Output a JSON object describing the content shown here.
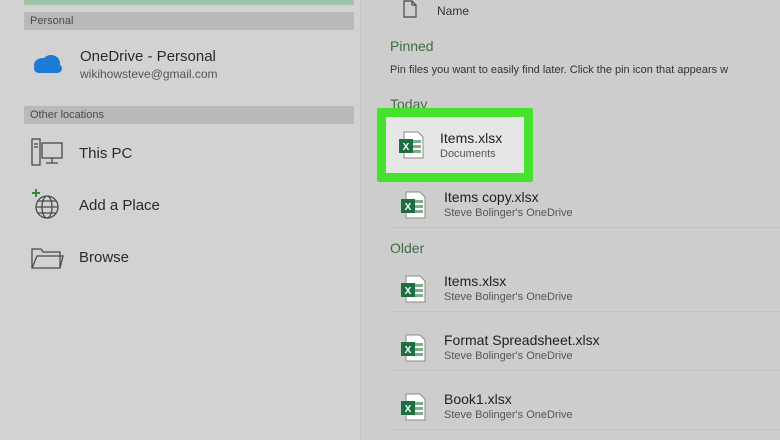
{
  "sidebar": {
    "personal_label": "Personal",
    "onedrive": {
      "title": "OneDrive - Personal",
      "email": "wikihowsteve@gmail.com"
    },
    "other_locations_label": "Other locations",
    "locations": [
      {
        "label": "This PC",
        "icon": "computer-icon"
      },
      {
        "label": "Add a Place",
        "icon": "add-globe-icon"
      },
      {
        "label": "Browse",
        "icon": "folder-icon"
      }
    ]
  },
  "file_list": {
    "column_name": "Name",
    "pinned": {
      "title": "Pinned",
      "hint": "Pin files you want to easily find later. Click the pin icon that appears w"
    },
    "today": {
      "title": "Today",
      "files": [
        {
          "name": "Items.xlsx",
          "location": "Documents"
        },
        {
          "name": "Items copy.xlsx",
          "location": "Steve Bolinger's OneDrive"
        }
      ]
    },
    "older": {
      "title": "Older",
      "files": [
        {
          "name": "Items.xlsx",
          "location": "Steve Bolinger's OneDrive"
        },
        {
          "name": "Format Spreadsheet.xlsx",
          "location": "Steve Bolinger's OneDrive"
        },
        {
          "name": "Book1.xlsx",
          "location": "Steve Bolinger's OneDrive"
        }
      ]
    }
  },
  "colors": {
    "highlight": "#45e32b",
    "excel_green": "#1d6f42",
    "group_title": "#3f6b44",
    "onedrive_blue": "#1c7bd2"
  }
}
